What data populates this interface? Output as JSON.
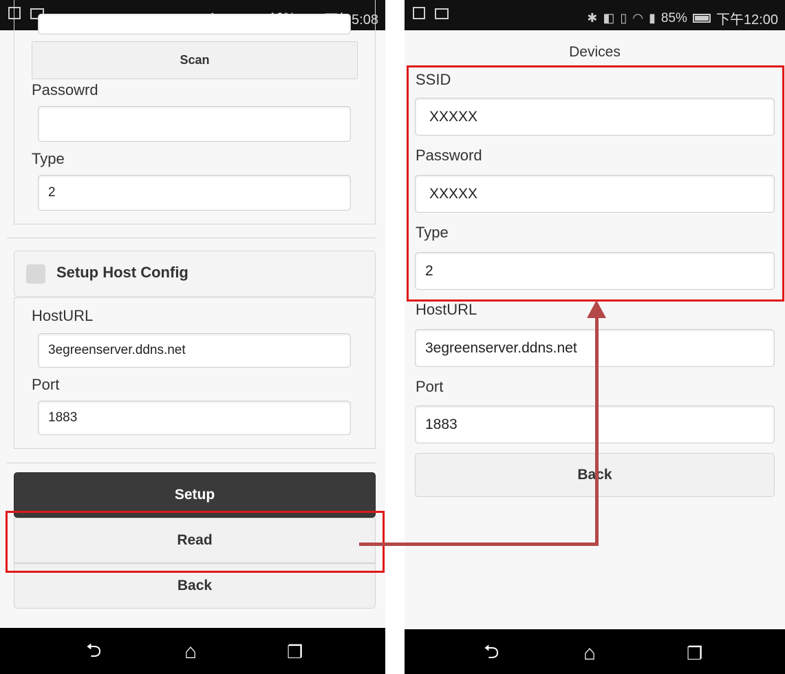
{
  "left_screen": {
    "status": {
      "battery_pct": "19%",
      "time": "下午5:08",
      "battery_level": 0.19
    },
    "scan_label": "Scan",
    "password_label": "Passowrd",
    "password_value": "",
    "type_label": "Type",
    "type_value": "2",
    "host_section_label": "Setup Host Config",
    "hosturl_label": "HostURL",
    "hosturl_value": "3egreenserver.ddns.net",
    "port_label": "Port",
    "port_value": "1883",
    "setup_label": "Setup",
    "read_label": "Read",
    "back_label": "Back"
  },
  "right_screen": {
    "status": {
      "battery_pct": "85%",
      "time": "下午12:00",
      "battery_level": 0.85
    },
    "title": "Devices",
    "ssid_label": "SSID",
    "ssid_value": "XXXXX",
    "password_label": "Password",
    "password_value": "XXXXX",
    "type_label": "Type",
    "type_value": "2",
    "hosturl_label": "HostURL",
    "hosturl_value": "3egreenserver.ddns.net",
    "port_label": "Port",
    "port_value": "1883",
    "back_label": "Back"
  },
  "colors": {
    "highlight_red": "#e01818",
    "arrow": "#b44848",
    "setup_button_bg": "#3a3a3a"
  },
  "icons": [
    "bluetooth-icon",
    "nfc-icon",
    "wifi-icon",
    "signal-icon",
    "battery-icon",
    "back-nav-icon",
    "home-nav-icon",
    "recents-nav-icon",
    "mail-icon",
    "sim-icon"
  ]
}
